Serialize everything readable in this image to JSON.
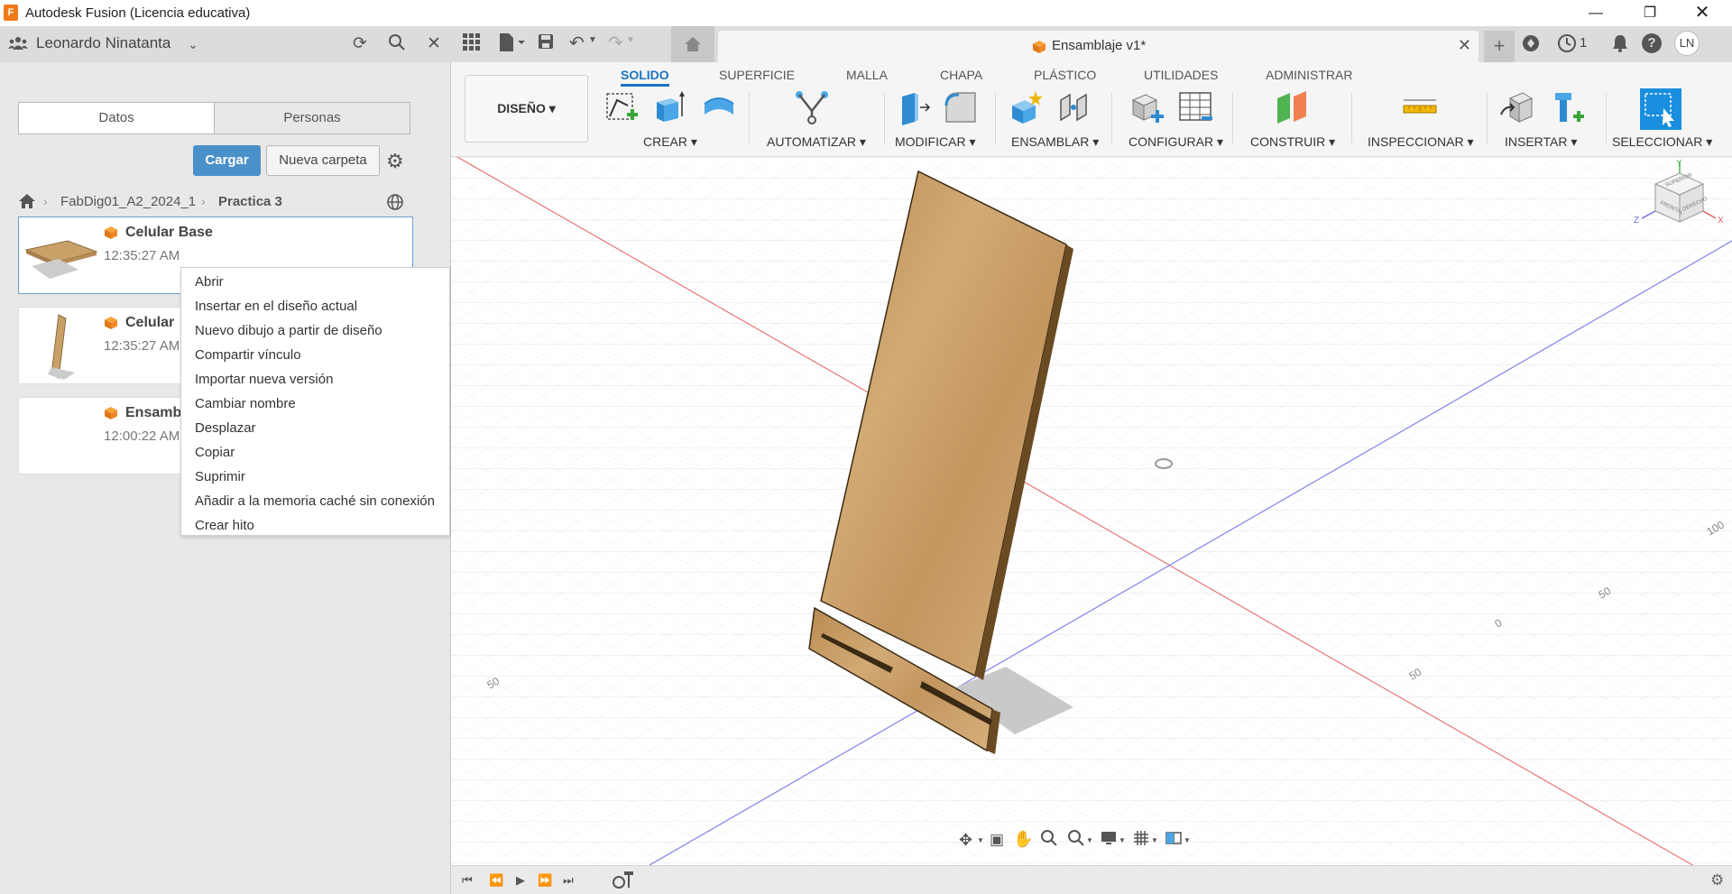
{
  "window": {
    "title": "Autodesk Fusion (Licencia educativa)",
    "app_icon": "F",
    "controls": [
      "minimize-icon",
      "restore-icon",
      "close-icon"
    ]
  },
  "data_panel": {
    "user_name": "Leonardo Ninatanta",
    "header_icons": [
      "team-icon",
      "refresh-icon",
      "search-icon",
      "close-icon"
    ],
    "segments": [
      "Datos",
      "Personas"
    ],
    "upload_label": "Cargar",
    "new_folder_label": "Nueva carpeta",
    "breadcrumb": [
      "FabDig01_A2_2024_1",
      "Practica 3"
    ],
    "files": [
      {
        "name": "Celular Base",
        "time": "12:35:27 AM"
      },
      {
        "name": "Celular",
        "time": "12:35:27 AM"
      },
      {
        "name": "Ensamb",
        "time": "12:00:22 AM"
      }
    ]
  },
  "context_menu": {
    "items": [
      "Abrir",
      "Insertar en el diseño actual",
      "Nuevo dibujo a partir de diseño",
      "Compartir vínculo",
      "Importar nueva versión",
      "Cambiar nombre",
      "Desplazar",
      "Copiar",
      "Suprimir",
      "Añadir a la memoria caché sin conexión",
      "Crear hito"
    ]
  },
  "document": {
    "tab_title": "Ensamblaje v1*",
    "job_count": "1",
    "user_initials": "LN"
  },
  "toolbar": {
    "workspace": "DISEÑO",
    "tabs": [
      "SOLIDO",
      "SUPERFICIE",
      "MALLA",
      "CHAPA",
      "PLÁSTICO",
      "UTILIDADES",
      "ADMINISTRAR"
    ],
    "active_tab": "SOLIDO",
    "groups": [
      "CREAR",
      "AUTOMATIZAR",
      "MODIFICAR",
      "ENSAMBLAR",
      "CONFIGURAR",
      "CONSTRUIR",
      "INSPECCIONAR",
      "INSERTAR",
      "SELECCIONAR"
    ]
  },
  "viewcube": {
    "faces": [
      "SUPERIOR",
      "FRONTAL",
      "DERECHO"
    ],
    "axes": [
      "Y",
      "Z",
      "X"
    ]
  },
  "grid_labels": [
    "100",
    "50",
    "0",
    "50",
    "50"
  ],
  "colors": {
    "accent": "#1a73c0",
    "primary_button": "#4a90c9",
    "wood": "#c9a068",
    "x_axis": "#e06060",
    "z_axis": "#7070e0"
  }
}
